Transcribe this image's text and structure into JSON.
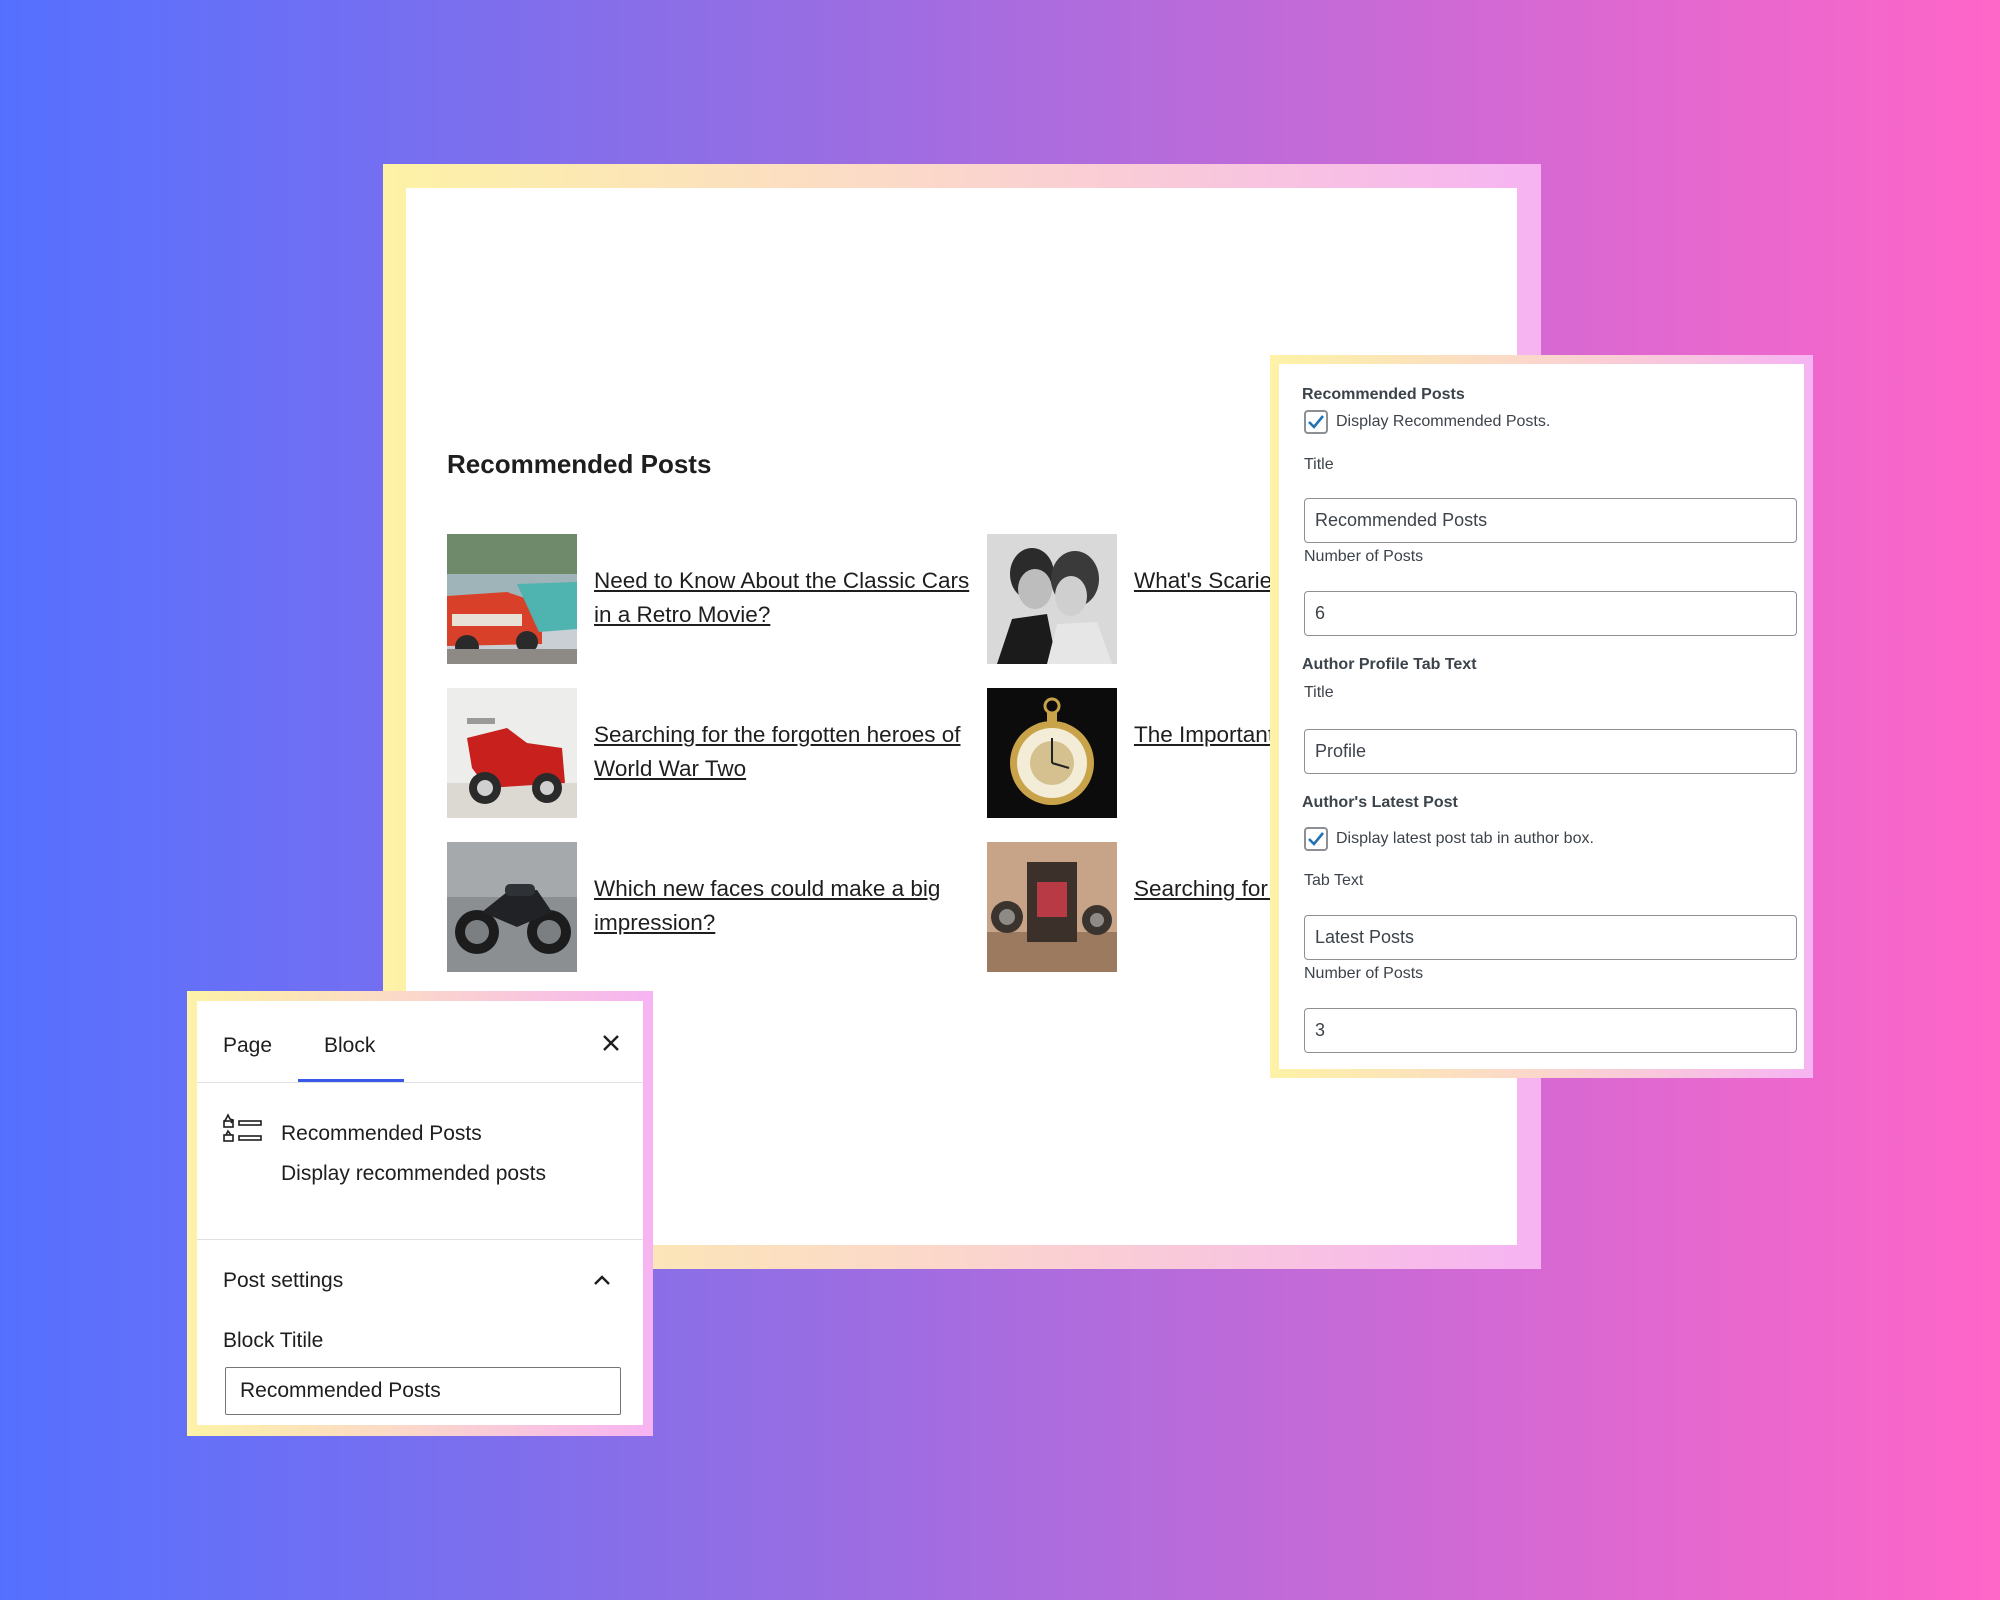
{
  "preview": {
    "heading": "Recommended Posts",
    "posts": [
      {
        "title": "Need to Know About the Classic Cars in a Retro Movie?",
        "image": "classic-cars-photo"
      },
      {
        "title": "What's Scarier Its About Weird",
        "image": "vintage-couple-photo"
      },
      {
        "title": "Searching for the forgotten heroes of World War Two",
        "image": "red-scooter-photo"
      },
      {
        "title": "The Important Aspects of Bu",
        "image": "pocket-watch-photo"
      },
      {
        "title": "Which new faces could make a big impression?",
        "image": "motorcycle-photo"
      },
      {
        "title": "Searching for me on Westm",
        "image": "vintage-camera-photo"
      }
    ]
  },
  "settings": {
    "section_label": "Recommended Posts",
    "display_checkbox_label": "Display Recommended Posts.",
    "display_checked": true,
    "title_label": "Title",
    "title_value": "Recommended Posts",
    "number_label": "Number of Posts",
    "number_value": "6",
    "author_tab_label": "Author Profile Tab Text",
    "author_title_label": "Title",
    "author_title_value": "Profile",
    "latest_label": "Author's Latest Post",
    "latest_checkbox_label": "Display latest post tab in author box.",
    "latest_checked": true,
    "tab_text_label": "Tab Text",
    "tab_text_value": "Latest Posts",
    "latest_number_label": "Number of Posts",
    "latest_number_value": "3"
  },
  "inspector": {
    "tab_page": "Page",
    "tab_block": "Block",
    "block_title": "Recommended Posts",
    "block_description": "Display recommended posts",
    "section_title": "Post settings",
    "field_label": "Block Titile",
    "field_value": "Recommended Posts"
  },
  "colors": {
    "accent": "#3858e9",
    "check": "#2271b1"
  }
}
